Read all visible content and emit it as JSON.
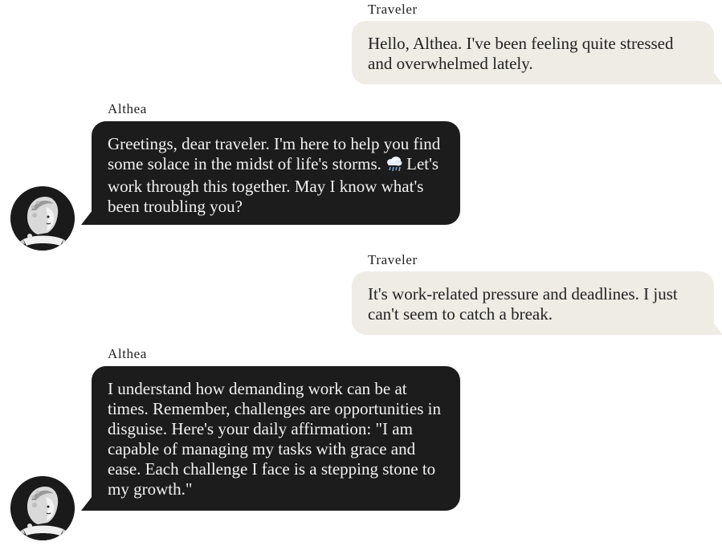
{
  "messages": [
    {
      "role": "user",
      "sender": "Traveler",
      "text": "Hello, Althea. I've been feeling quite stressed and overwhelmed lately."
    },
    {
      "role": "assistant",
      "sender": "Althea",
      "text_before_icon": "Greetings, dear traveler. I'm here to help you find some solace in the midst of life's storms.",
      "icon": "cloud-rain-icon",
      "text_after_icon": "Let's work through this together. May I know what's been troubling you?",
      "avatar": "althea-portrait-icon"
    },
    {
      "role": "user",
      "sender": "Traveler",
      "text": "It's work-related pressure and deadlines. I just can't seem to catch a break."
    },
    {
      "role": "assistant",
      "sender": "Althea",
      "text": "I understand how demanding work can be at times. Remember, challenges are opportunities in disguise. Here's your daily affirmation: \"I am capable of managing my tasks with grace and ease. Each challenge I face is a stepping stone to my growth.\"",
      "avatar": "althea-portrait-icon"
    }
  ],
  "colors": {
    "user_bubble": "#efebe5",
    "assistant_bubble": "#1c1c1c",
    "assistant_text": "#f2f2f2",
    "user_text": "#222222"
  }
}
